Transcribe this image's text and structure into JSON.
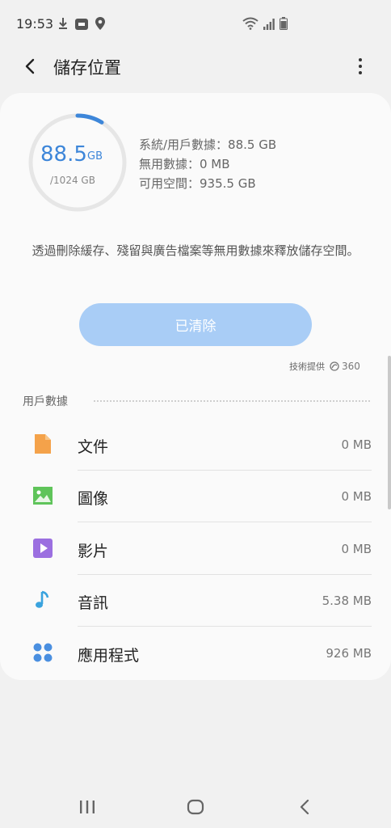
{
  "status_bar": {
    "time": "19:53",
    "left_icons": [
      "download-icon",
      "app-notification-icon",
      "location-icon"
    ],
    "right_icons": [
      "wifi-icon",
      "signal-icon",
      "battery-icon"
    ]
  },
  "app_bar": {
    "title": "儲存位置"
  },
  "storage": {
    "used_value": "88.5",
    "used_unit": "GB",
    "total": "/1024 GB",
    "used_fraction": 0.0864,
    "accent_color": "#3d86d9",
    "stats": {
      "system_user": "系統/用戶數據：88.5 GB",
      "junk": "無用數據：0 MB",
      "available": "可用空間：935.5 GB"
    }
  },
  "description": "透過刪除緩存、殘留與廣告檔案等無用數據來釋放儲存空間。",
  "clean_button": {
    "label": "已清除",
    "color": "#a9cdf6"
  },
  "powered_by": {
    "label": "技術提供",
    "brand": "360"
  },
  "user_data": {
    "section_title": "用戶數據",
    "items": [
      {
        "label": "文件",
        "size": "0 MB",
        "icon": "document-icon",
        "color": "#f4a24a"
      },
      {
        "label": "圖像",
        "size": "0 MB",
        "icon": "image-icon",
        "color": "#5fc45a"
      },
      {
        "label": "影片",
        "size": "0 MB",
        "icon": "video-icon",
        "color": "#9b6fe0"
      },
      {
        "label": "音訊",
        "size": "5.38 MB",
        "icon": "music-note-icon",
        "color": "#3aa3de"
      },
      {
        "label": "應用程式",
        "size": "926 MB",
        "icon": "apps-icon",
        "color": "#4a8fe0"
      }
    ]
  },
  "nav_bar": {
    "buttons": [
      "recent-apps-icon",
      "home-icon",
      "back-icon"
    ]
  }
}
